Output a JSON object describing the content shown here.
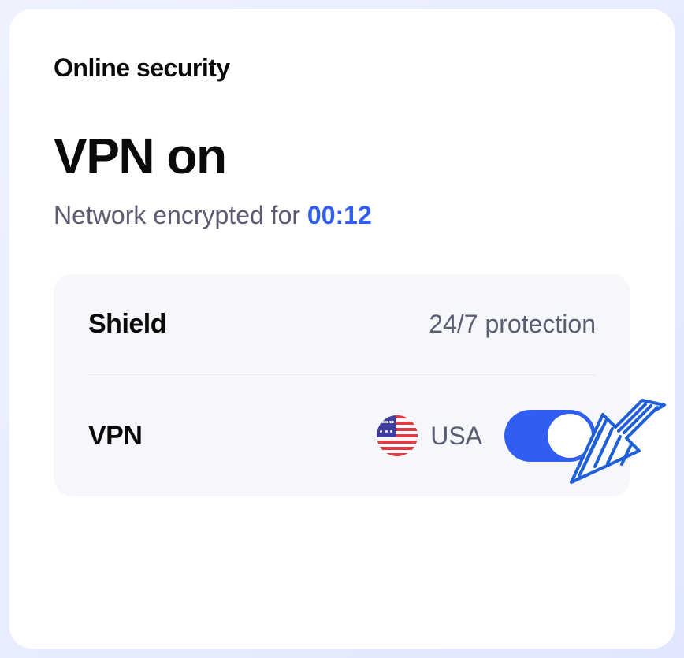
{
  "header": {
    "section_title": "Online security",
    "main_title": "VPN on",
    "subtitle_prefix": "Network encrypted for ",
    "duration": "00:12"
  },
  "panel": {
    "shield": {
      "label": "Shield",
      "value": "24/7 protection"
    },
    "vpn": {
      "label": "VPN",
      "country": "USA",
      "toggle_on": true
    }
  },
  "colors": {
    "accent": "#2f5ef0",
    "text_primary": "#0a0a0a",
    "text_secondary": "#5b5b72",
    "panel_bg": "#f6f7fb"
  }
}
